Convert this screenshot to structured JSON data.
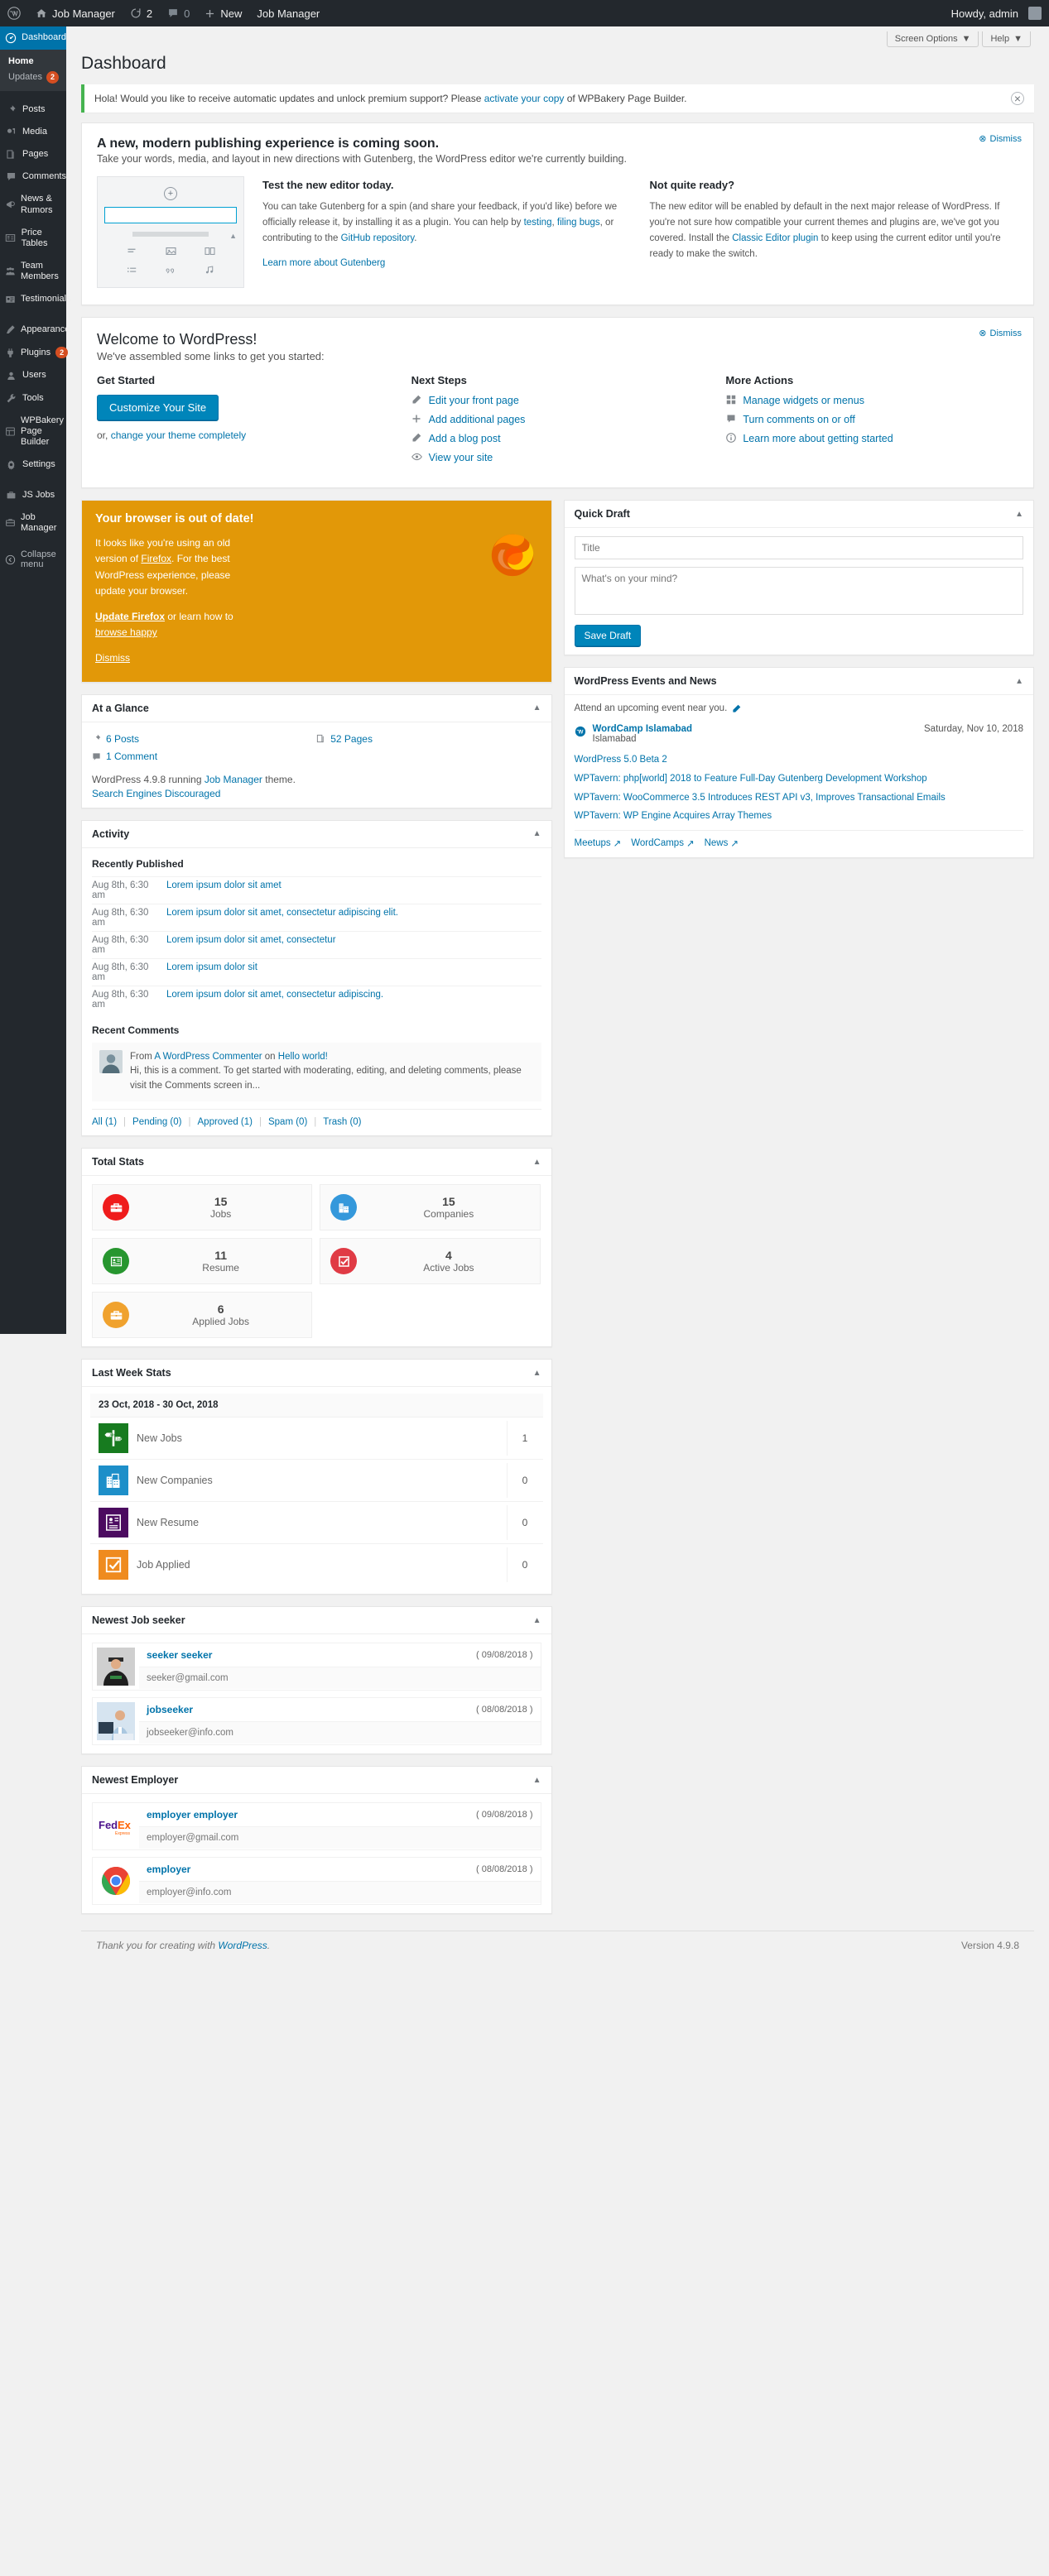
{
  "adminbar": {
    "wp_logo": "wordpress-logo-icon",
    "site_name": "Job Manager",
    "updates_icon": "updates-icon",
    "updates_count": "2",
    "comments_icon": "comments-icon",
    "comments_count": "0",
    "new_label": "New",
    "new_icon": "plus-icon",
    "extra_item": "Job Manager",
    "howdy": "Howdy, admin"
  },
  "sidebar": {
    "items": [
      {
        "label": "Dashboard",
        "icon": "dashboard-icon",
        "current": true
      },
      {
        "label": "Posts",
        "icon": "pin-icon"
      },
      {
        "label": "Media",
        "icon": "media-icon"
      },
      {
        "label": "Pages",
        "icon": "pages-icon"
      },
      {
        "label": "Comments",
        "icon": "comment-icon"
      },
      {
        "label": "News & Rumors",
        "icon": "megaphone-icon"
      },
      {
        "label": "Price Tables",
        "icon": "table-icon"
      },
      {
        "label": "Team Members",
        "icon": "group-icon"
      },
      {
        "label": "Testimonials",
        "icon": "testimonial-icon"
      },
      {
        "label": "Appearance",
        "icon": "brush-icon"
      },
      {
        "label": "Plugins",
        "icon": "plugins-icon",
        "badge": "2"
      },
      {
        "label": "Users",
        "icon": "users-icon"
      },
      {
        "label": "Tools",
        "icon": "tools-icon"
      },
      {
        "label": "WPBakery Page Builder",
        "icon": "wpbakery-icon"
      },
      {
        "label": "Settings",
        "icon": "settings-icon"
      },
      {
        "label": "JS Jobs",
        "icon": "jsjobs-icon"
      },
      {
        "label": "Job Manager",
        "icon": "jobmanager-icon"
      }
    ],
    "submenu": [
      {
        "label": "Home",
        "current": true
      },
      {
        "label": "Updates",
        "badge": "2"
      }
    ],
    "collapse_label": "Collapse menu",
    "collapse_icon": "collapse-arrow-icon"
  },
  "screen_meta": {
    "screen_options": "Screen Options",
    "help": "Help",
    "caret_icon": "chevron-down-icon"
  },
  "page": {
    "title": "Dashboard"
  },
  "notice": {
    "text_before": "Hola! Would you like to receive automatic updates and unlock premium support? Please ",
    "link": "activate your copy",
    "text_after": " of WPBakery Page Builder.",
    "dismiss_icon": "close-circle-icon"
  },
  "gutenberg": {
    "dismiss": "Dismiss",
    "dismiss_icon": "close-circle-icon",
    "title": "A new, modern publishing experience is coming soon.",
    "subtitle": "Take your words, media, and layout in new directions with Gutenberg, the WordPress editor we're currently building.",
    "mock": {
      "plus_icon": "plus-circle-icon",
      "icons": [
        "paragraph-icon",
        "image-icon",
        "gallery-icon",
        "list-icon",
        "quote-icon",
        "audio-icon"
      ]
    },
    "col1": {
      "heading": "Test the new editor today.",
      "body_1": "You can take Gutenberg for a spin (and share your feedback, if you'd like) before we officially release it, by installing it as a plugin. You can help by ",
      "link_testing": "testing",
      "mid": ", ",
      "link_filing": "filing bugs",
      "body_2": ", or contributing to the ",
      "link_github": "GitHub repository",
      "body_3": ".",
      "learn_more": "Learn more about Gutenberg"
    },
    "col2": {
      "heading": "Not quite ready?",
      "body_1": "The new editor will be enabled by default in the next major release of WordPress. If you're not sure how compatible your current themes and plugins are, we've got you covered. Install the ",
      "link_classic": "Classic Editor plugin",
      "body_2": " to keep using the current editor until you're ready to make the switch."
    }
  },
  "welcome": {
    "dismiss": "Dismiss",
    "dismiss_icon": "close-circle-icon",
    "heading": "Welcome to WordPress!",
    "subheading": "We've assembled some links to get you started:",
    "col1": {
      "heading": "Get Started",
      "button": "Customize Your Site",
      "note_before": "or, ",
      "note_link": "change your theme completely"
    },
    "col2": {
      "heading": "Next Steps",
      "items": [
        {
          "label": "Edit your front page",
          "icon": "edit-icon"
        },
        {
          "label": "Add additional pages",
          "icon": "plus-icon"
        },
        {
          "label": "Add a blog post",
          "icon": "post-icon"
        },
        {
          "label": "View your site",
          "icon": "eye-icon"
        }
      ]
    },
    "col3": {
      "heading": "More Actions",
      "items": [
        {
          "label": "Manage widgets or menus",
          "icon": "widgets-icon"
        },
        {
          "label": "Turn comments on or off",
          "icon": "comment-icon"
        },
        {
          "label": "Learn more about getting started",
          "icon": "info-icon"
        }
      ]
    }
  },
  "browser_nag": {
    "title": "Your browser is out of date!",
    "p1_before": "It looks like you're using an old version of ",
    "p1_link": "Firefox",
    "p1_after": ". For the best WordPress experience, please update your browser.",
    "update_link": "Update Firefox",
    "or_text": " or learn how to ",
    "browse_link": "browse happy",
    "dismiss": "Dismiss",
    "logo_icon": "firefox-logo-icon"
  },
  "quick_draft": {
    "title": "Quick Draft",
    "toggle_icon": "chevron-up-icon",
    "title_placeholder": "Title",
    "title_value": "",
    "content_placeholder": "What's on your mind?",
    "content_value": "",
    "save_label": "Save Draft"
  },
  "events": {
    "title": "WordPress Events and News",
    "toggle_icon": "chevron-up-icon",
    "intro": "Attend an upcoming event near you.",
    "edit_icon": "pencil-icon",
    "event": {
      "flag_icon": "wordcamp-icon",
      "name": "WordCamp Islamabad",
      "location": "Islamabad",
      "date": "Saturday, Nov 10, 2018"
    },
    "news": [
      "WordPress 5.0 Beta 2",
      "WPTavern: php[world] 2018 to Feature Full-Day Gutenberg Development Workshop",
      "WPTavern: WooCommerce 3.5 Introduces REST API v3, Improves Transactional Emails",
      "WPTavern: WP Engine Acquires Array Themes"
    ],
    "footer_links": [
      "Meetups",
      "WordCamps",
      "News"
    ],
    "external_icon": "external-link-icon"
  },
  "at_a_glance": {
    "title": "At a Glance",
    "toggle_icon": "chevron-up-icon",
    "items": [
      {
        "label": "6 Posts",
        "icon": "pin-icon"
      },
      {
        "label": "52 Pages",
        "icon": "pages-icon"
      },
      {
        "label": "1 Comment",
        "icon": "comment-icon"
      }
    ],
    "note_before": "WordPress 4.9.8 running ",
    "note_link": "Job Manager",
    "note_after": " theme.",
    "search_engines": "Search Engines Discouraged"
  },
  "activity": {
    "title": "Activity",
    "toggle_icon": "chevron-up-icon",
    "recently_published": "Recently Published",
    "posts": [
      {
        "date": "Aug 8th, 6:30 am",
        "title": "Lorem ipsum dolor sit amet"
      },
      {
        "date": "Aug 8th, 6:30 am",
        "title": "Lorem ipsum dolor sit amet, consectetur adipiscing elit."
      },
      {
        "date": "Aug 8th, 6:30 am",
        "title": "Lorem ipsum dolor sit amet, consectetur"
      },
      {
        "date": "Aug 8th, 6:30 am",
        "title": "Lorem ipsum dolor sit"
      },
      {
        "date": "Aug 8th, 6:30 am",
        "title": "Lorem ipsum dolor sit amet, consectetur adipiscing."
      }
    ],
    "recent_comments": "Recent Comments",
    "comment": {
      "from": "From",
      "author": "A WordPress Commenter",
      "on": "on",
      "post": "Hello world!",
      "body": "Hi, this is a comment. To get started with moderating, editing, and deleting comments, please visit the Comments screen in..."
    },
    "filters": [
      "All (1)",
      "Pending (0)",
      "Approved (1)",
      "Spam (0)",
      "Trash (0)"
    ]
  },
  "total_stats": {
    "title": "Total Stats",
    "toggle_icon": "chevron-up-icon",
    "cards": [
      {
        "value": "15",
        "label": "Jobs",
        "icon": "briefcase-icon",
        "color": "#ef1c1c"
      },
      {
        "value": "15",
        "label": "Companies",
        "icon": "building-icon",
        "color": "#3498db"
      },
      {
        "value": "11",
        "label": "Resume",
        "icon": "resume-icon",
        "color": "#27962f"
      },
      {
        "value": "4",
        "label": "Active Jobs",
        "icon": "check-box-icon",
        "color": "#e03b45"
      },
      {
        "value": "6",
        "label": "Applied Jobs",
        "icon": "briefcase-icon",
        "color": "#f0a22e"
      }
    ]
  },
  "last_week_stats": {
    "title": "Last Week Stats",
    "toggle_icon": "chevron-up-icon",
    "range": "23 Oct, 2018 - 30 Oct, 2018",
    "rows": [
      {
        "label": "New Jobs",
        "value": "1",
        "icon": "signpost-icon",
        "color": "#177b1f"
      },
      {
        "label": "New Companies",
        "value": "0",
        "icon": "building-icon",
        "color": "#1d8fc9"
      },
      {
        "label": "New Resume",
        "value": "0",
        "icon": "resume-icon",
        "color": "#4c0b60"
      },
      {
        "label": "Job Applied",
        "value": "0",
        "icon": "check-box-icon",
        "color": "#ef8b1f"
      }
    ]
  },
  "newest_job_seeker": {
    "title": "Newest Job seeker",
    "toggle_icon": "chevron-up-icon",
    "people": [
      {
        "name": "seeker seeker",
        "date": "( 09/08/2018 )",
        "email": "seeker@gmail.com",
        "avatar": "photo-man-cap"
      },
      {
        "name": "jobseeker",
        "date": "( 08/08/2018 )",
        "email": "jobseeker@info.com",
        "avatar": "photo-man-desk"
      }
    ]
  },
  "newest_employer": {
    "title": "Newest Employer",
    "toggle_icon": "chevron-up-icon",
    "people": [
      {
        "name": "employer employer",
        "date": "( 09/08/2018 )",
        "email": "employer@gmail.com",
        "avatar": "fedex-logo"
      },
      {
        "name": "employer",
        "date": "( 08/08/2018 )",
        "email": "employer@info.com",
        "avatar": "chrome-logo"
      }
    ]
  },
  "footer": {
    "thanks_before": "Thank you for creating with ",
    "thanks_link": "WordPress",
    "thanks_after": ".",
    "version": "Version 4.9.8"
  }
}
